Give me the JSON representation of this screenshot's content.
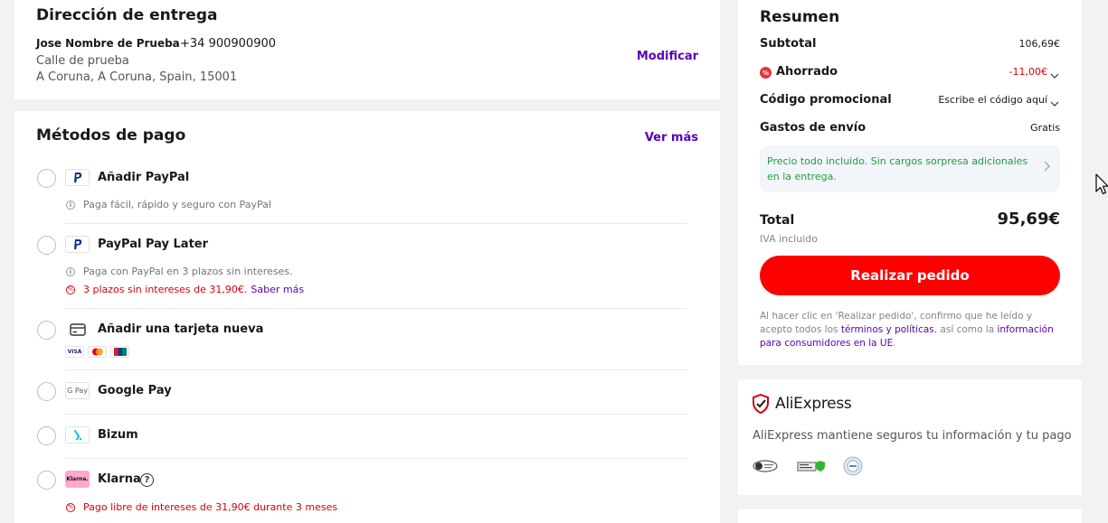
{
  "address": {
    "title": "Dirección de entrega",
    "name": "Jose Nombre de Prueba",
    "phone": "+34 900900900",
    "street": "Calle de prueba",
    "city_line": "A Coruna, A Coruna, Spain, 15001",
    "modify_label": "Modificar"
  },
  "payment": {
    "title": "Métodos de pago",
    "see_more_label": "Ver más",
    "methods": [
      {
        "label": "Añadir PayPal",
        "info": "Paga fácil, rápido y seguro con PayPal",
        "icon": "paypal-icon"
      },
      {
        "label": "PayPal Pay Later",
        "info": "Paga con PayPal en 3 plazos sin intereses.",
        "promo": "3 plazos sin intereses de 31,90€.",
        "promo_link": "Saber más",
        "icon": "paypal-icon"
      },
      {
        "label": "Añadir una tarjeta nueva",
        "icon": "credit-card-icon",
        "cards": [
          "VISA",
          "MC",
          "UP"
        ]
      },
      {
        "label": "Google Pay",
        "icon": "google-pay-icon",
        "logo_text": "G Pay"
      },
      {
        "label": "Bizum",
        "icon": "bizum-icon"
      },
      {
        "label": "Klarna",
        "icon": "klarna-icon",
        "logo_text": "Klarna.",
        "promo": "Pago libre de intereses de 31,90€ durante 3 meses"
      }
    ]
  },
  "summary": {
    "title": "Resumen",
    "subtotal_label": "Subtotal",
    "subtotal_value": "106,69€",
    "saved_label": "Ahorrado",
    "saved_value": "-11,00€",
    "promo_label": "Código promocional",
    "promo_placeholder": "Escribe el código aquí",
    "shipping_label": "Gastos de envío",
    "shipping_value": "Gratis",
    "notice": "Precio todo incluido. Sin cargos sorpresa adicionales en la entrega.",
    "total_label": "Total",
    "total_value": "95,69€",
    "vat_label": "IVA incluido",
    "place_order_label": "Realizar pedido",
    "legal_prefix": "Al hacer clic en 'Realizar pedido', confirmo que he leído y acepto todos los ",
    "legal_terms": "términos y políticas",
    "legal_middle": ", así como la ",
    "legal_info": "información para consumidores en la UE",
    "legal_end": "."
  },
  "trust": {
    "brand": "AliExpress",
    "text": "AliExpress mantiene seguros tu información y tu pago"
  },
  "colors": {
    "accent_purple": "#5a00b4",
    "order_red": "#fd0000",
    "saved_red": "#d4000e",
    "notice_green": "#1e9e3c"
  }
}
